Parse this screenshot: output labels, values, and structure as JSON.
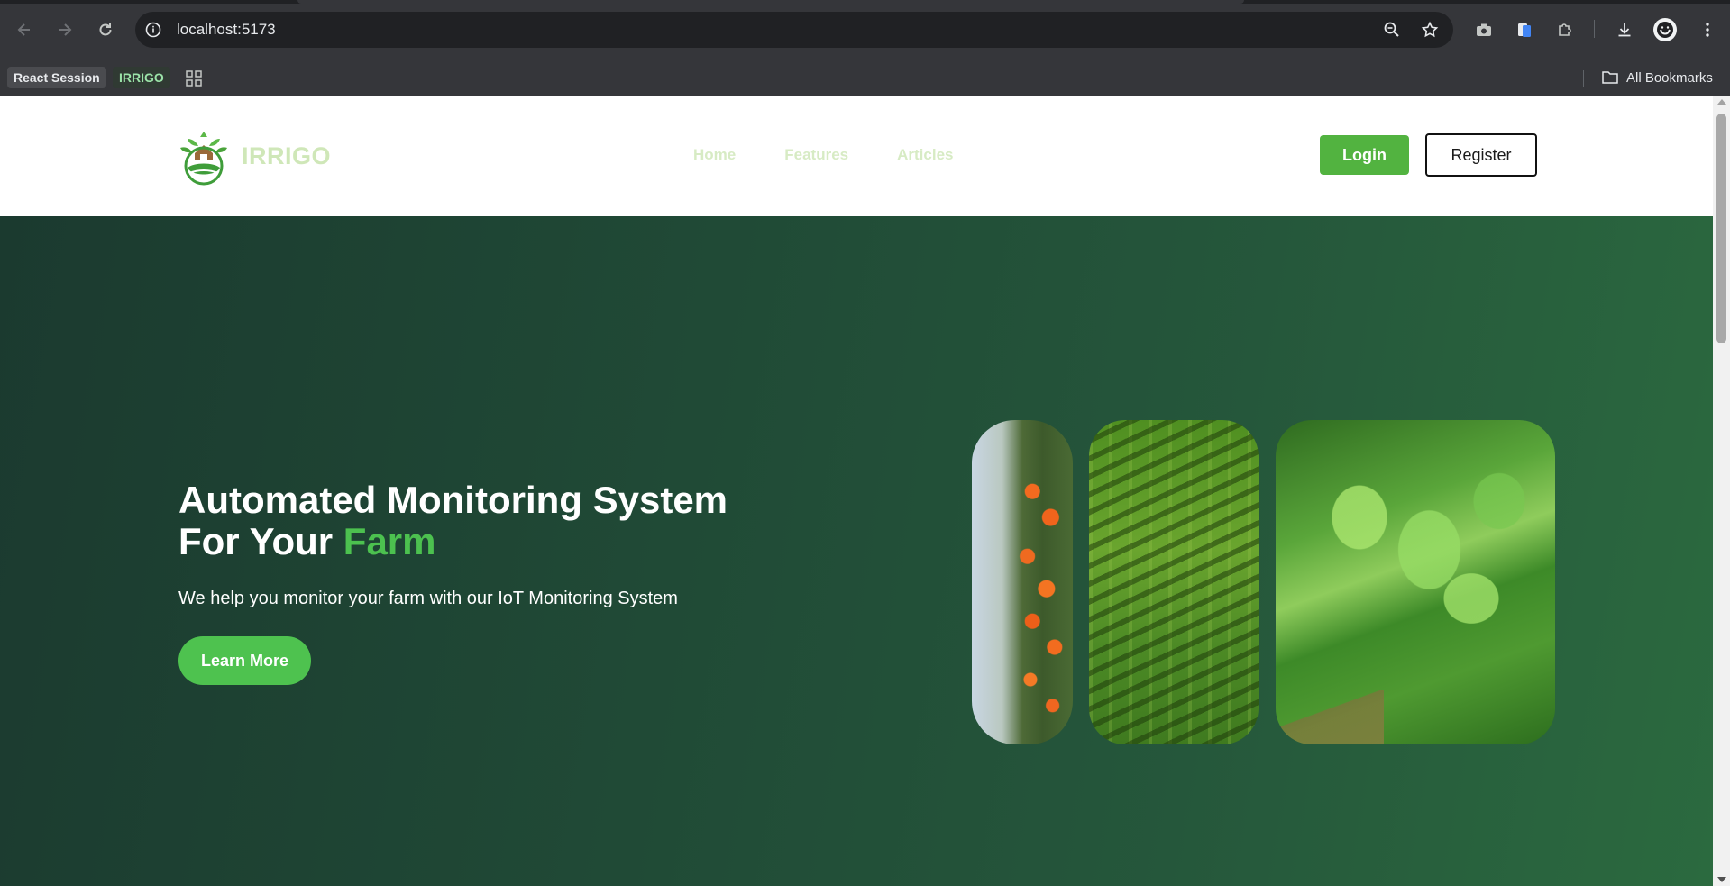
{
  "browser": {
    "url": "localhost:5173",
    "bookmarks": [
      {
        "label": "React Session"
      },
      {
        "label": "IRRIGO"
      }
    ],
    "all_bookmarks_label": "All Bookmarks"
  },
  "site": {
    "brand": "IRRIGO",
    "nav": [
      {
        "label": "Home"
      },
      {
        "label": "Features"
      },
      {
        "label": "Articles"
      }
    ],
    "login_label": "Login",
    "register_label": "Register"
  },
  "hero": {
    "title_line1": "Automated Monitoring System",
    "title_line2_prefix": "For Your ",
    "title_line2_accent": "Farm",
    "subtitle": "We help you monitor your farm with our IoT Monitoring System",
    "cta_label": "Learn More"
  },
  "colors": {
    "accent": "#4ec24f",
    "login_button": "#52b340",
    "hero_start": "#1b3a2f",
    "hero_end": "#2b6a3f",
    "nav_text": "#d7ebc4"
  }
}
